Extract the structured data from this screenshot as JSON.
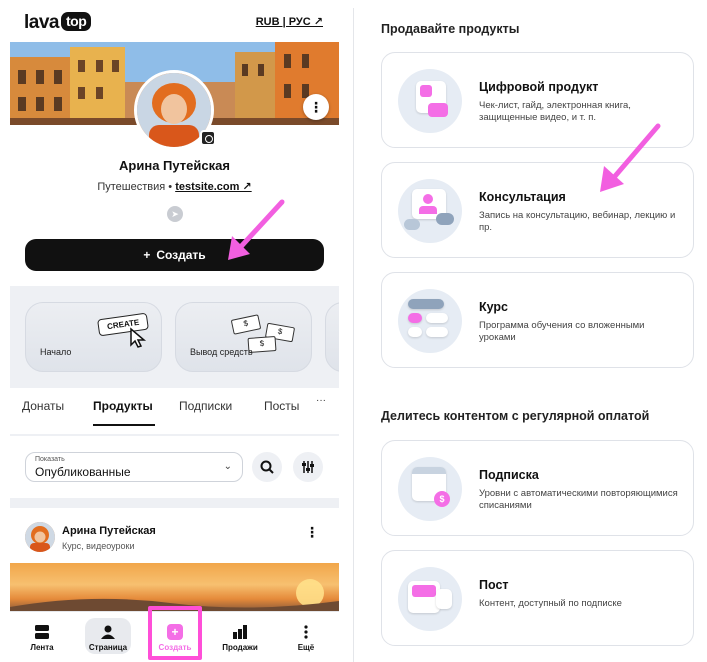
{
  "header": {
    "logo_main": "lava",
    "logo_badge": "top",
    "lang_switch": "RUB | РУС ↗"
  },
  "profile": {
    "name": "Арина Путейская",
    "category": "Путешествия",
    "dot": "•",
    "site": "testsite.com ↗",
    "telegram_glyph": "➤"
  },
  "create_button": {
    "label": "Создать",
    "plus": "+"
  },
  "tiles": [
    {
      "label": "Начало",
      "badge": "CREATE"
    },
    {
      "label": "Вывод средств",
      "money_glyph": "$"
    }
  ],
  "tabs": [
    "Донаты",
    "Продукты",
    "Подписки",
    "Посты",
    "···"
  ],
  "active_tab": "Продукты",
  "filter": {
    "caption": "Показать",
    "value": "Опубликованные",
    "chevron": "⌄"
  },
  "post": {
    "author": "Арина Путейская",
    "meta": "Курс, видеоуроки",
    "menu_glyph": "⋮"
  },
  "cover_menu_glyph": "⋮",
  "bottom_nav": [
    {
      "label": "Лента",
      "icon": "feed-icon"
    },
    {
      "label": "Страница",
      "icon": "person-icon"
    },
    {
      "label": "Создать",
      "icon": "plus-icon"
    },
    {
      "label": "Продажи",
      "icon": "bar-chart-icon"
    },
    {
      "label": "Ещё",
      "icon": "more-icon"
    }
  ],
  "sections": {
    "sell": {
      "title": "Продавайте продукты",
      "items": [
        {
          "title": "Цифровой продукт",
          "desc": "Чек-лист, гайд, электронная книга, защищенные видео, и т. п."
        },
        {
          "title": "Консультация",
          "desc": "Запись на консультацию, вебинар, лекцию и пр."
        },
        {
          "title": "Курс",
          "desc": "Программа обучения со вложенными уроками"
        }
      ]
    },
    "share": {
      "title": "Делитесь контентом с регулярной оплатой",
      "items": [
        {
          "title": "Подписка",
          "desc": "Уровни с автоматическими повторяющимися списаниями"
        },
        {
          "title": "Пост",
          "desc": "Контент, доступный по подписке"
        }
      ]
    }
  },
  "colors": {
    "accent_pink": "#f46ee6",
    "arrow_pink": "#f25fe0",
    "dark": "#111111"
  }
}
